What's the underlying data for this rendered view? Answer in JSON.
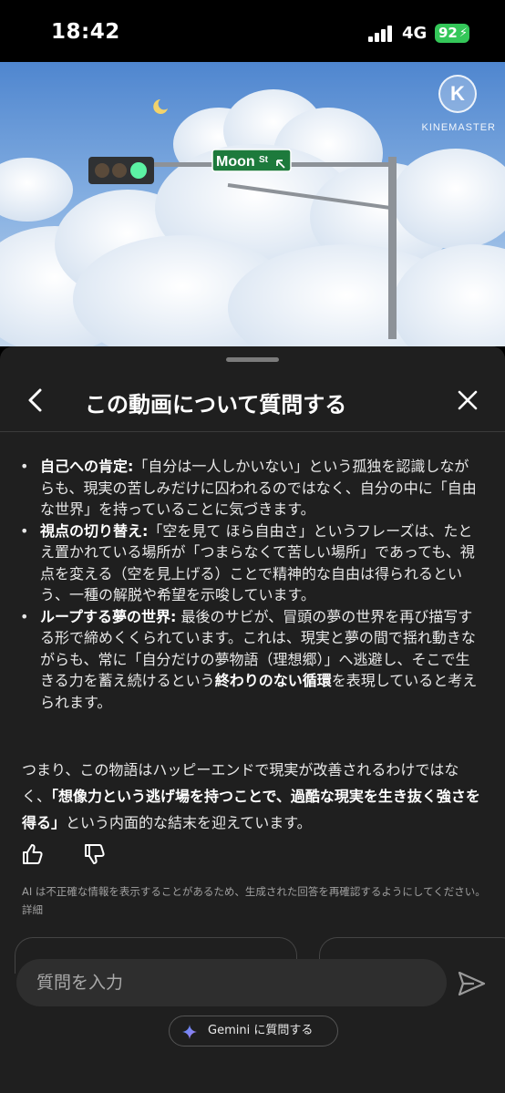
{
  "status_bar": {
    "time": "18:42",
    "network": "4G",
    "battery": "92"
  },
  "video": {
    "sign_text": "Moon",
    "sign_suffix": "St",
    "watermark": "KINEMASTER",
    "watermark_letter": "K"
  },
  "sheet": {
    "title": "この動画について質問する"
  },
  "answer": {
    "bullets": [
      {
        "bold": "自己への肯定:",
        "text": "「自分は一人しかいない」という孤独を認識しながらも、現実の苦しみだけに囚われるのではなく、自分の中に「自由な世界」を持っていることに気づきます。"
      },
      {
        "bold": "視点の切り替え:",
        "text": "「空を見て ほら自由さ」というフレーズは、たとえ置かれている場所が「つまらなくて苦しい場所」であっても、視点を変える（空を見上げる）ことで精神的な自由は得られるという、一種の解脱や希望を示唆しています。"
      },
      {
        "bold": "ループする夢の世界:",
        "text": "最後のサビが、冒頭の夢の世界を再び描写する形で締めくくられています。これは、現実と夢の間で揺れ動きながらも、常に「自分だけの夢物語（理想郷）」へ逃避し、そこで生きる力を蓄え続けるという",
        "bold2": "終わりのない循環",
        "tail": "を表現していると考えられます。"
      }
    ],
    "summary_pre": "つまり、この物語はハッピーエンドで現実が改善されるわけではなく、",
    "summary_bold": "「想像力という逃げ場を持つことで、過酷な現実を生き抜く強さを得る」",
    "summary_post": "という内面的な結末を迎えています。"
  },
  "disclaimer": {
    "text": "AI は不正確な情報を表示することがあるため、生成された回答を再確認するようにしてください。",
    "link": "詳細"
  },
  "input": {
    "placeholder": "質問を入力"
  },
  "gemini_button": {
    "label": "Gemini に質問する"
  },
  "colors": {
    "sheet_bg": "#1f1f1f",
    "input_bg": "#2e2e2e",
    "battery": "#34c759",
    "sky": "#6f9fd8"
  },
  "icons": [
    "signal-icon",
    "battery-icon",
    "back-arrow-icon",
    "close-icon",
    "thumbs-up-icon",
    "thumbs-down-icon",
    "send-icon",
    "gemini-sparkle-icon"
  ]
}
